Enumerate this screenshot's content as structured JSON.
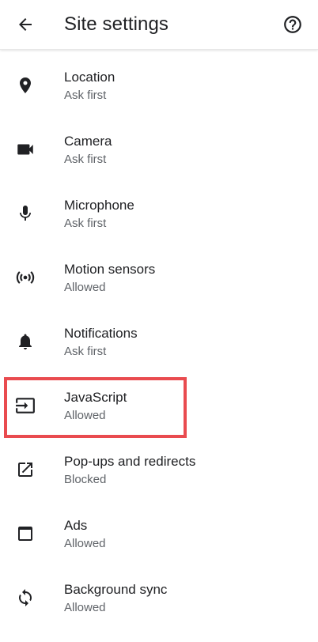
{
  "header": {
    "title": "Site settings",
    "back_icon": "arrow-back-icon",
    "help_icon": "help-circle-icon"
  },
  "settings": [
    {
      "label": "Location",
      "status": "Ask first",
      "icon": "location-pin-icon"
    },
    {
      "label": "Camera",
      "status": "Ask first",
      "icon": "videocam-icon"
    },
    {
      "label": "Microphone",
      "status": "Ask first",
      "icon": "microphone-icon"
    },
    {
      "label": "Motion sensors",
      "status": "Allowed",
      "icon": "sensors-icon"
    },
    {
      "label": "Notifications",
      "status": "Ask first",
      "icon": "bell-icon"
    },
    {
      "label": "JavaScript",
      "status": "Allowed",
      "icon": "javascript-input-icon"
    },
    {
      "label": "Pop-ups and redirects",
      "status": "Blocked",
      "icon": "open-in-new-icon"
    },
    {
      "label": "Ads",
      "status": "Allowed",
      "icon": "ads-window-icon"
    },
    {
      "label": "Background sync",
      "status": "Allowed",
      "icon": "sync-icon"
    }
  ],
  "highlight": {
    "target": "JavaScript",
    "color": "#e94b4f"
  },
  "colors": {
    "primary_text": "#202124",
    "secondary_text": "#5f6368",
    "icon": "#202124"
  }
}
